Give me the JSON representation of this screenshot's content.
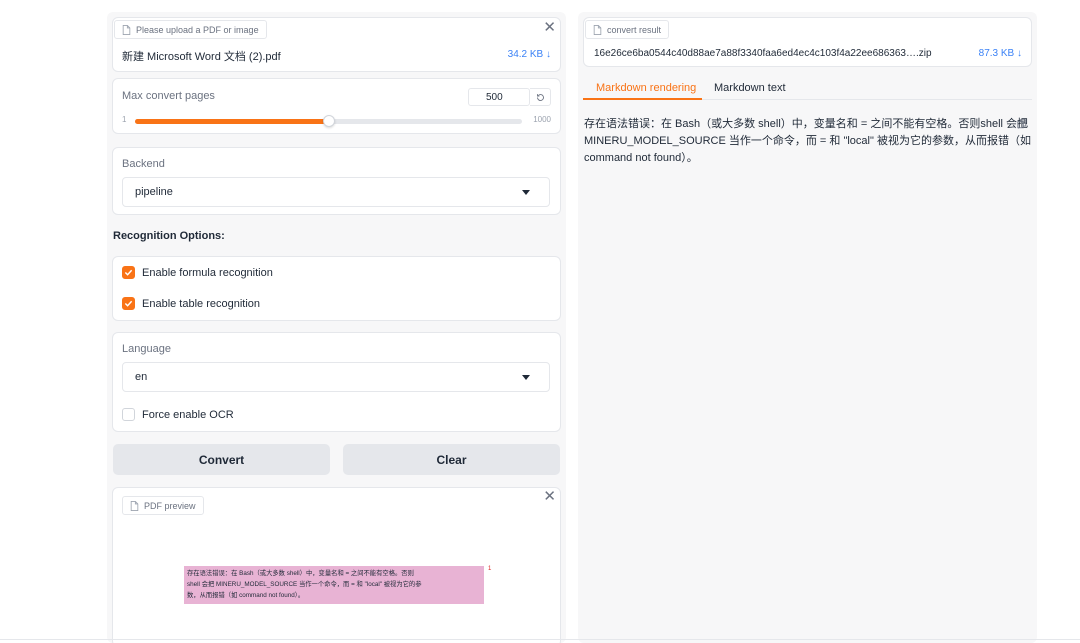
{
  "upload": {
    "tag": "Please upload a PDF or image",
    "file_name": "新建 Microsoft Word 文档 (2).pdf",
    "file_size": "34.2 KB ↓"
  },
  "max_pages": {
    "label": "Max convert pages",
    "value": "500",
    "min": "1",
    "max": "1000",
    "fraction": 0.5
  },
  "backend": {
    "label": "Backend",
    "selected": "pipeline"
  },
  "recognition": {
    "title": "Recognition Options:",
    "formula_label": "Enable formula recognition",
    "formula_checked": true,
    "table_label": "Enable table recognition",
    "table_checked": true
  },
  "language": {
    "label": "Language",
    "selected": "en",
    "force_ocr_label": "Force enable OCR",
    "force_ocr_checked": false
  },
  "buttons": {
    "convert": "Convert",
    "clear": "Clear"
  },
  "preview": {
    "tag": "PDF preview",
    "lines": [
      "存在语法错误：在 Bash（或大多数 shell）中，变量名和 = 之间不能有空格。否则",
      "shell 会把 MINERU_MODEL_SOURCE 当作一个命令，而 = 和 \"local\" 被视为它的参",
      "数，从而报错（如 command not found）。"
    ],
    "marker": "1"
  },
  "result": {
    "tag": "convert result",
    "file_name": "16e26ce6ba0544c40d88ae7a88f3340faa6ed4ec4c103f4a22ee686363….zip",
    "file_size": "87.3 KB ↓",
    "tabs": [
      "Markdown rendering",
      "Markdown text"
    ],
    "markdown_lines": [
      "存在语法错误：在 Bash（或大多数 shell）中，变量名和 = 之间不能有空格。否则shell 会把",
      "MINERU_MODEL_SOURCE 当作一个命令，而 = 和 \"local\" 被视为它的参数，从而报错（如",
      "command not found）。"
    ]
  },
  "colors": {
    "accent": "#f97316",
    "link": "#3b82f6",
    "highlight": "#e8b3d4"
  },
  "icons": [
    "file-icon",
    "close-icon",
    "reset-icon",
    "chevron-down-icon",
    "check-icon",
    "copy-icon"
  ]
}
